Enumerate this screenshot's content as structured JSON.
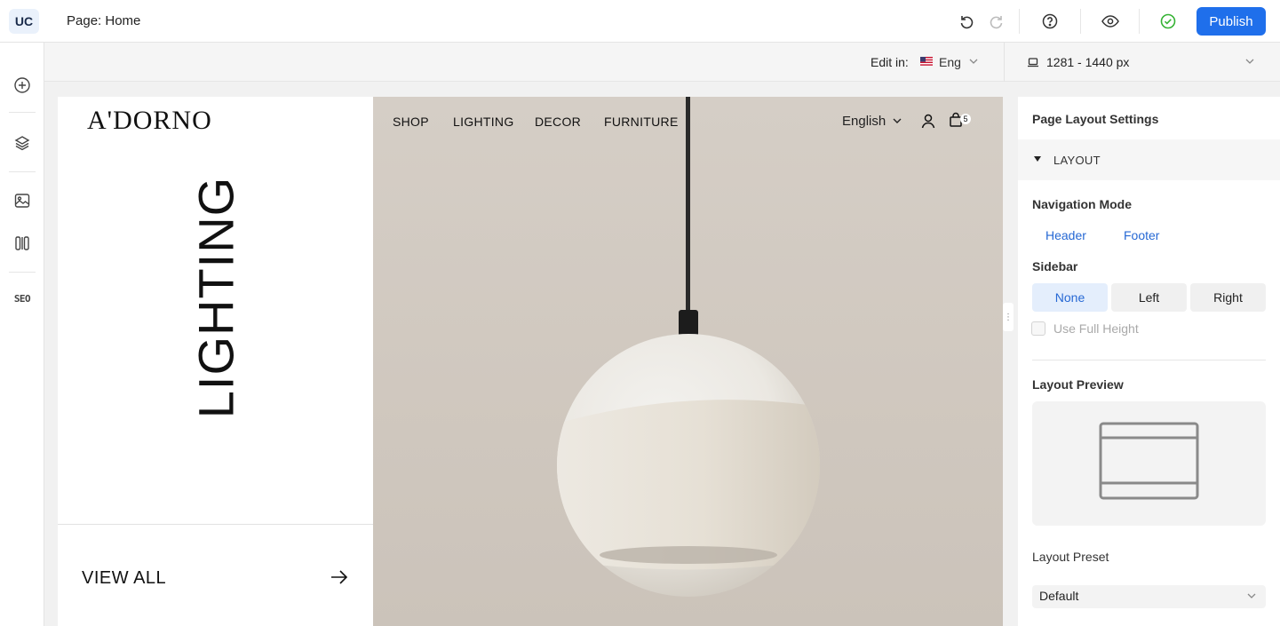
{
  "app": {
    "logo": "UC",
    "page_title": "Page: Home",
    "publish_label": "Publish"
  },
  "topbar_icons": [
    "undo-icon",
    "redo-icon",
    "help-icon",
    "preview-eye-icon",
    "saved-check-icon"
  ],
  "rail": {
    "seo_label": "SEO",
    "icons": [
      "add-icon",
      "layers-icon",
      "media-icon",
      "columns-icon"
    ]
  },
  "subbar": {
    "edit_in_label": "Edit in:",
    "language": "Eng",
    "device_range": "1281  - 1440 px"
  },
  "site": {
    "brand": "A'DORNO",
    "hero_title": "LIGHTING",
    "nav": [
      "SHOP",
      "LIGHTING",
      "DECOR",
      "FURNITURE"
    ],
    "language": "English",
    "cart_count": "5",
    "view_all": "VIEW ALL"
  },
  "panel": {
    "title": "Page Layout Settings",
    "section": "LAYOUT",
    "navigation_mode_label": "Navigation Mode",
    "navigation_modes": [
      "Header",
      "Footer"
    ],
    "sidebar_label": "Sidebar",
    "sidebar_options": [
      "None",
      "Left",
      "Right"
    ],
    "sidebar_selected": "None",
    "use_full_height": "Use Full Height",
    "layout_preview_label": "Layout Preview",
    "layout_preset_label": "Layout Preset",
    "layout_preset_value": "Default"
  },
  "colors": {
    "accent": "#1f6feb",
    "link": "#2668d4",
    "success": "#34b233",
    "hero_bg": "#d3ccc4"
  }
}
